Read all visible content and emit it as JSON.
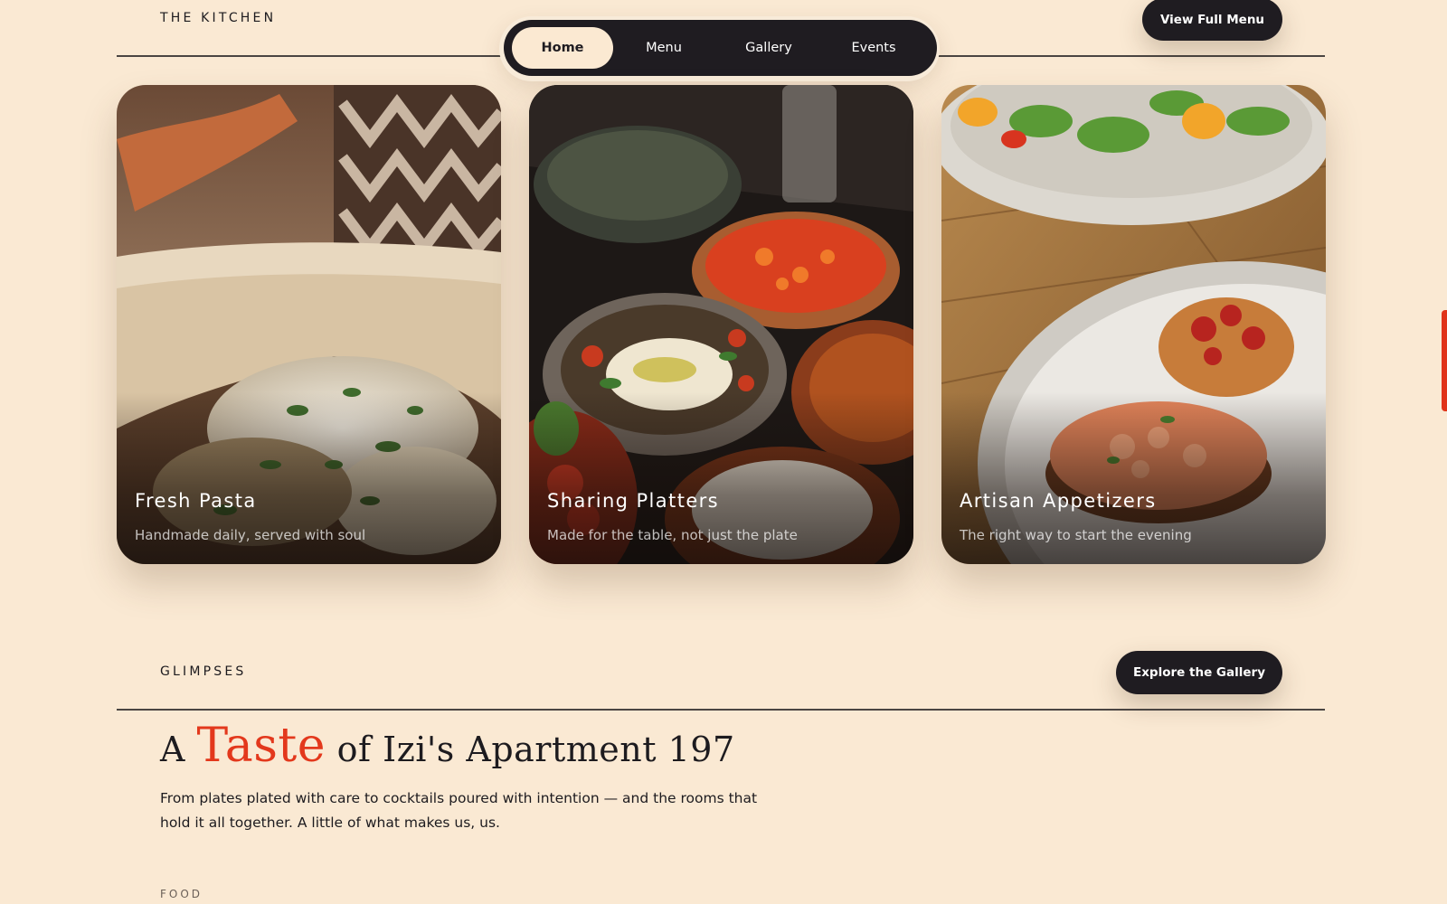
{
  "kitchen_section": {
    "label": "THE KITCHEN",
    "cta_label": "View Full Menu"
  },
  "nav": {
    "items": [
      "Home",
      "Menu",
      "Gallery",
      "Events"
    ],
    "active_index": 0
  },
  "cards": [
    {
      "title": "Fresh Pasta",
      "subtitle": "Handmade daily, served with soul"
    },
    {
      "title": "Sharing Platters",
      "subtitle": "Made for the table, not just the plate"
    },
    {
      "title": "Artisan Appetizers",
      "subtitle": "The right way to start the evening"
    }
  ],
  "glimpses_section": {
    "label": "GLIMPSES",
    "cta_label": "Explore the Gallery",
    "headline_prefix": "A",
    "headline_accent": "Taste",
    "headline_suffix": "of Izi's Apartment 197",
    "intro": "From plates plated with care to cocktails poured with intention — and the rooms that hold it all together. A little of what makes us, us.",
    "category_label": "FOOD"
  },
  "colors": {
    "background": "#fae9d3",
    "dark": "#1f1c21",
    "accent": "#e3381c"
  }
}
